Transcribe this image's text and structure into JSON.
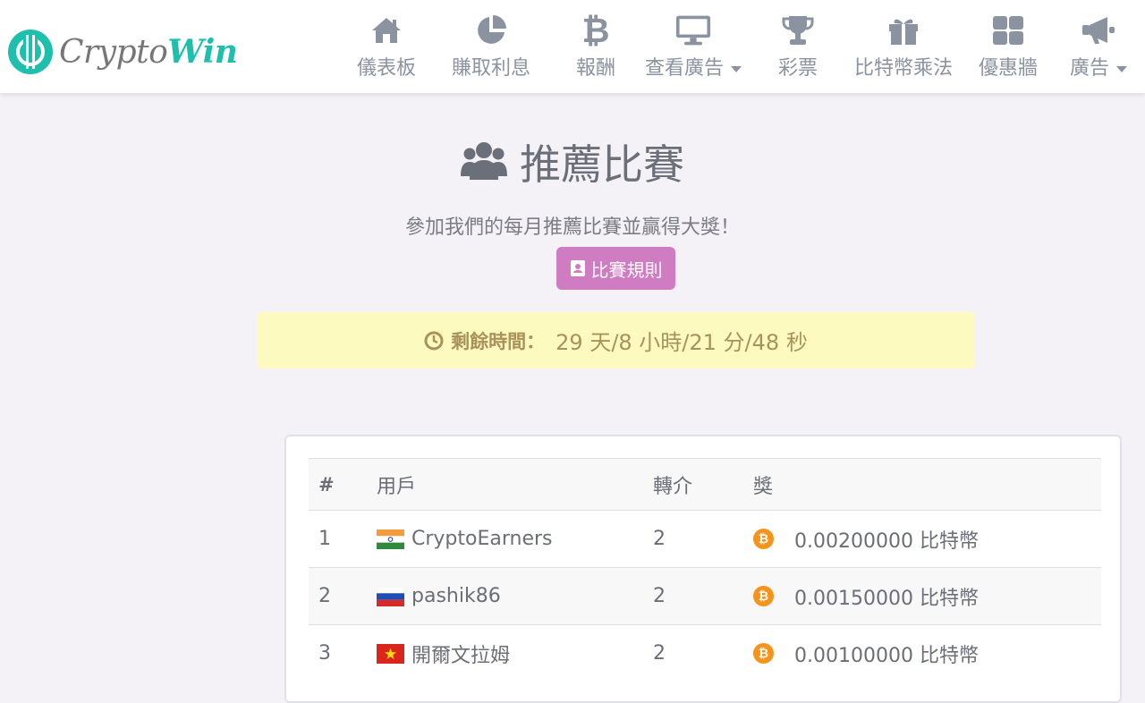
{
  "brand": {
    "name_part1": "Crypto",
    "name_part2": "Win",
    "colors": {
      "teal": "#1fbfae",
      "grey": "#777777"
    }
  },
  "nav": {
    "items": [
      {
        "label": "儀表板",
        "icon": "home-icon"
      },
      {
        "label": "賺取利息",
        "icon": "pie-chart-icon"
      },
      {
        "label": "報酬",
        "icon": "bitcoin-icon"
      },
      {
        "label": "查看廣告",
        "icon": "monitor-icon",
        "dropdown": true
      },
      {
        "label": "彩票",
        "icon": "trophy-icon"
      },
      {
        "label": "比特幣乘法",
        "icon": "gift-icon"
      },
      {
        "label": "優惠牆",
        "icon": "grid-icon"
      },
      {
        "label": "廣告",
        "icon": "megaphone-icon",
        "dropdown": true
      }
    ]
  },
  "header": {
    "title": "推薦比賽",
    "title_icon": "users-icon",
    "subtitle": "參加我們的每月推薦比賽並贏得大獎！",
    "rules_button": "比賽規則",
    "rules_button_color": "#cf7cc2"
  },
  "timer": {
    "label": "剩餘時間：",
    "value": "29 天/8 小時/21 分/48 秒",
    "icon": "clock-icon",
    "background": "#fdfac0"
  },
  "table": {
    "headers": {
      "rank": "#",
      "user": "用戶",
      "referrals": "轉介",
      "prize": "獎"
    },
    "rows": [
      {
        "rank": "1",
        "flag": "india-flag",
        "user": "CryptoEarners",
        "referrals": "2",
        "prize": "0.00200000 比特幣"
      },
      {
        "rank": "2",
        "flag": "russia-flag",
        "user": "pashik86",
        "referrals": "2",
        "prize": "0.00150000 比特幣"
      },
      {
        "rank": "3",
        "flag": "vietnam-flag",
        "user": "開爾文拉姆",
        "referrals": "2",
        "prize": "0.00100000 比特幣"
      }
    ],
    "coin_icon": "bitcoin-coin-icon",
    "coin_color": "#f7931a"
  }
}
